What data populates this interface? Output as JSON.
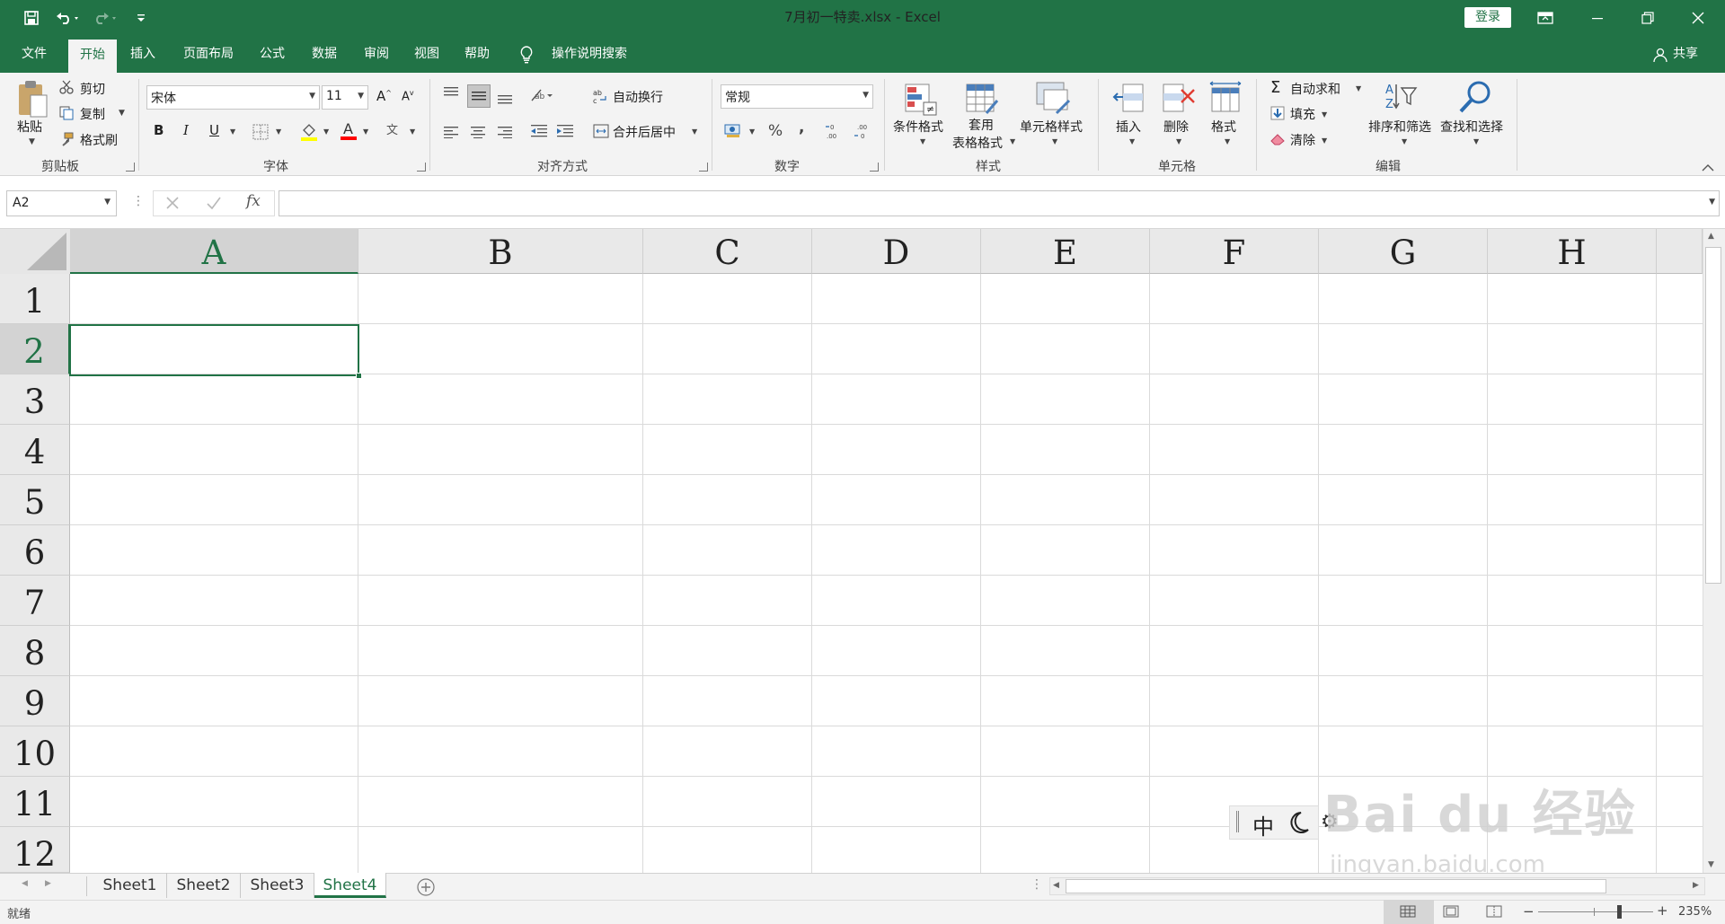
{
  "window": {
    "title": "7月初一特卖.xlsx - Excel",
    "login_label": "登录"
  },
  "tabs": [
    "文件",
    "开始",
    "插入",
    "页面布局",
    "公式",
    "数据",
    "审阅",
    "视图",
    "帮助"
  ],
  "active_tab": "开始",
  "tell_me": "操作说明搜索",
  "share": "共享",
  "clipboard": {
    "paste": "粘贴",
    "cut": "剪切",
    "copy": "复制",
    "format_painter": "格式刷",
    "label": "剪贴板"
  },
  "font": {
    "name": "宋体",
    "size": "11",
    "label": "字体",
    "bold": "B",
    "italic": "I",
    "underline": "U"
  },
  "alignment": {
    "wrap": "自动换行",
    "merge": "合并后居中",
    "label": "对齐方式"
  },
  "number": {
    "format": "常规",
    "label": "数字",
    "percent": "%",
    "comma": ","
  },
  "styles": {
    "conditional": "条件格式",
    "table1": "套用",
    "table2": "表格格式",
    "cell": "单元格样式",
    "label": "样式"
  },
  "cells": {
    "insert": "插入",
    "delete": "删除",
    "format": "格式",
    "label": "单元格"
  },
  "editing": {
    "autosum": "自动求和",
    "fill": "填充",
    "clear": "清除",
    "sort": "排序和筛选",
    "find": "查找和选择",
    "label": "编辑"
  },
  "formula_bar": {
    "name_box": "A2",
    "fx": "fx",
    "formula": ""
  },
  "columns": [
    "A",
    "B",
    "C",
    "D",
    "E",
    "F",
    "G",
    "H"
  ],
  "rows": [
    "1",
    "2",
    "3",
    "4",
    "5",
    "6",
    "7",
    "8",
    "9",
    "10",
    "11",
    "12"
  ],
  "selected_cell": "A2",
  "sheets": [
    "Sheet1",
    "Sheet2",
    "Sheet3",
    "Sheet4"
  ],
  "active_sheet": "Sheet4",
  "ime": {
    "mode": "中"
  },
  "watermark": {
    "brand": "Bai du 经验",
    "url": "jingyan.baidu.com"
  },
  "status": {
    "ready": "就绪",
    "zoom": "235%"
  }
}
